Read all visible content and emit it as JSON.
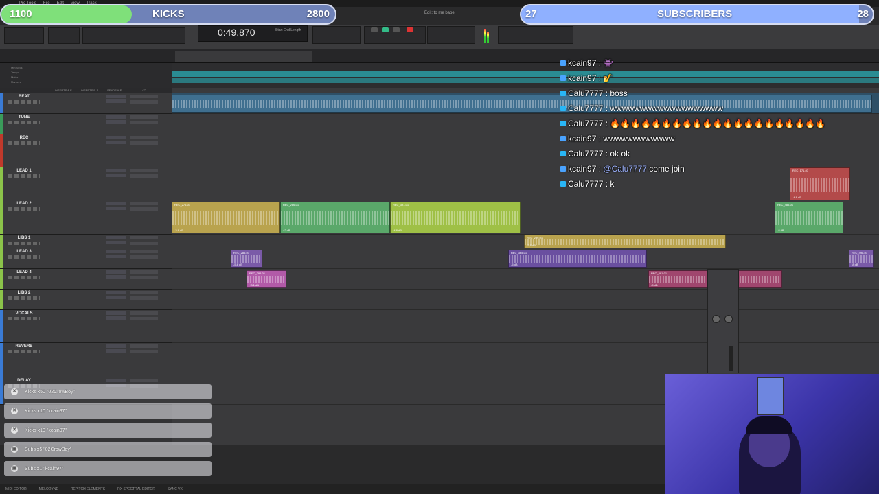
{
  "overlay": {
    "kicks": {
      "current": "1100",
      "label": "KICKS",
      "target": "2800",
      "progress": 0.39
    },
    "subscribers": {
      "current": "27",
      "label": "SUBSCRIBERS",
      "target": "28",
      "progress": 0.96
    }
  },
  "transport": {
    "counter": "0:49.870",
    "counter_sub": "Start\nEnd\nLength",
    "session_title": "Edit: to me babe",
    "cursor_label": "Cursor"
  },
  "rulers": [
    "Min:Secs",
    "Tempo",
    "Meter",
    "Markers"
  ],
  "track_header": {
    "inserts_ae": "INSERTS A-E",
    "inserts_fj": "INSERTS F-J",
    "sends_ae": "SENDS A-E",
    "io": "I / O"
  },
  "tracks": [
    {
      "name": "BEAT",
      "color": "#3a7bd5"
    },
    {
      "name": "TUNE",
      "color": "#3a9b5a"
    },
    {
      "name": "REC",
      "color": "#c0392b"
    },
    {
      "name": "LEAD 1",
      "color": "#8bc34a"
    },
    {
      "name": "LEAD 2",
      "color": "#8bc34a"
    },
    {
      "name": "LIBS 1",
      "color": "#8bc34a"
    },
    {
      "name": "LEAD 3",
      "color": "#8bc34a"
    },
    {
      "name": "LEAD 4",
      "color": "#8bc34a"
    },
    {
      "name": "LIBS 2",
      "color": "#8bc34a"
    },
    {
      "name": "VOCALS",
      "color": "#3a7bd5"
    },
    {
      "name": "REVERB",
      "color": "#3a7bd5"
    },
    {
      "name": "DELAY",
      "color": "#3a7bd5"
    }
  ],
  "clips": [
    {
      "name": "REC_276-01",
      "db": "-3.8 dB",
      "color": "#b9a34e"
    },
    {
      "name": "REC_286-01",
      "db": "+2 dB",
      "color": "#5aa86a"
    },
    {
      "name": "REC_391-01",
      "db": "-4.8 dB",
      "color": "#9fc046"
    },
    {
      "name": "REC_285-01",
      "db": "-5.8 dB",
      "color": "#7a5aa8"
    },
    {
      "name": "REC_295-01",
      "db": "+8.1 dB",
      "color": "#b25aa8"
    },
    {
      "name": "REC_365-01",
      "db": "-5 dB",
      "color": "#6a4fa0"
    },
    {
      "name": "REC_289-01",
      "db": "-5.8 dB",
      "color": "#b9a34e"
    },
    {
      "name": "REC_481-01",
      "db": "-5 dB",
      "color": "#a0466e"
    },
    {
      "name": "REC_171-03",
      "db": "-4.8 dB",
      "color": "#b34a4a"
    },
    {
      "name": "REC_485-01",
      "db": "-8 dB",
      "color": "#5aa86a"
    },
    {
      "name": "REC_498-01",
      "db": "-8 dB",
      "color": "#7a5aa8"
    }
  ],
  "chat": [
    {
      "user": "kcain97",
      "text": ":",
      "emoji": "👾",
      "badge": "#4aa3ff"
    },
    {
      "user": "kcain97",
      "text": ":",
      "emoji": "🎷",
      "badge": "#4aa3ff"
    },
    {
      "user": "Calu7777",
      "text": ": boss",
      "badge": "#29b6f6"
    },
    {
      "user": "Calu7777",
      "text": ": wwwwwwwwwwwwwwwwwww",
      "badge": "#29b6f6"
    },
    {
      "user": "Calu7777",
      "text": ": 🔥🔥🔥🔥🔥🔥🔥🔥🔥🔥🔥🔥🔥🔥🔥🔥🔥🔥🔥🔥🔥",
      "badge": "#29b6f6"
    },
    {
      "user": "kcain97",
      "text": ": wwwwwwwwwwww",
      "badge": "#4aa3ff"
    },
    {
      "user": "Calu7777",
      "text": ": ok ok",
      "badge": "#29b6f6"
    },
    {
      "user": "kcain97",
      "text": ":",
      "mention": "@Calu7777",
      "after": "come join",
      "badge": "#4aa3ff"
    },
    {
      "user": "Calu7777",
      "text": ": k",
      "badge": "#29b6f6"
    }
  ],
  "notifications": [
    {
      "text": "Kicks x50 \"02CrowBoy\"",
      "icon": "close-icon"
    },
    {
      "text": "Kicks x10 \"kcain97\"",
      "icon": "close-icon"
    },
    {
      "text": "Kicks x10 \"kcain97\"",
      "icon": "close-icon"
    },
    {
      "text": "Subs x5 \"02CrowBoy\"",
      "icon": "gift-icon"
    },
    {
      "text": "Subs x1 \"kcain97\"",
      "icon": "gift-icon"
    }
  ],
  "bottom_tabs": [
    "MIDI EDITOR",
    "MELODYNE",
    "REPITCH ELEMENTS",
    "RX SPECTRAL EDITOR",
    "SYNC VX"
  ]
}
